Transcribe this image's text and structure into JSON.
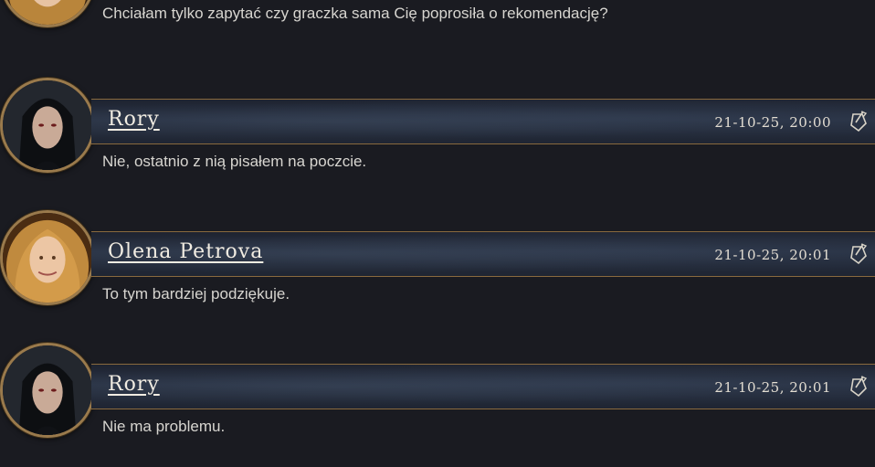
{
  "posts": [
    {
      "author": "",
      "date": "",
      "text": "Chciałam tylko zapytać czy graczka sama Cię poprosiła o rekomendację?",
      "avatar": "female-blonde"
    },
    {
      "author": "Rory",
      "date": "21-10-25, 20:00",
      "text": "Nie, ostatnio z nią pisałem na poczcie.",
      "avatar": "male-dark-hair"
    },
    {
      "author": "Olena Petrova",
      "date": "21-10-25, 20:01",
      "text": "To tym bardziej podziękuje.",
      "avatar": "female-blonde"
    },
    {
      "author": "Rory",
      "date": "21-10-25, 20:01",
      "text": "Nie ma problemu.",
      "avatar": "male-dark-hair"
    }
  ],
  "icons": {
    "quote": "quill-quote-icon"
  },
  "colors": {
    "background": "#1a1b21",
    "border_gold": "#9a7a4c",
    "bar": "#283143",
    "text": "#d7d5d0",
    "author": "#f1ece2"
  }
}
